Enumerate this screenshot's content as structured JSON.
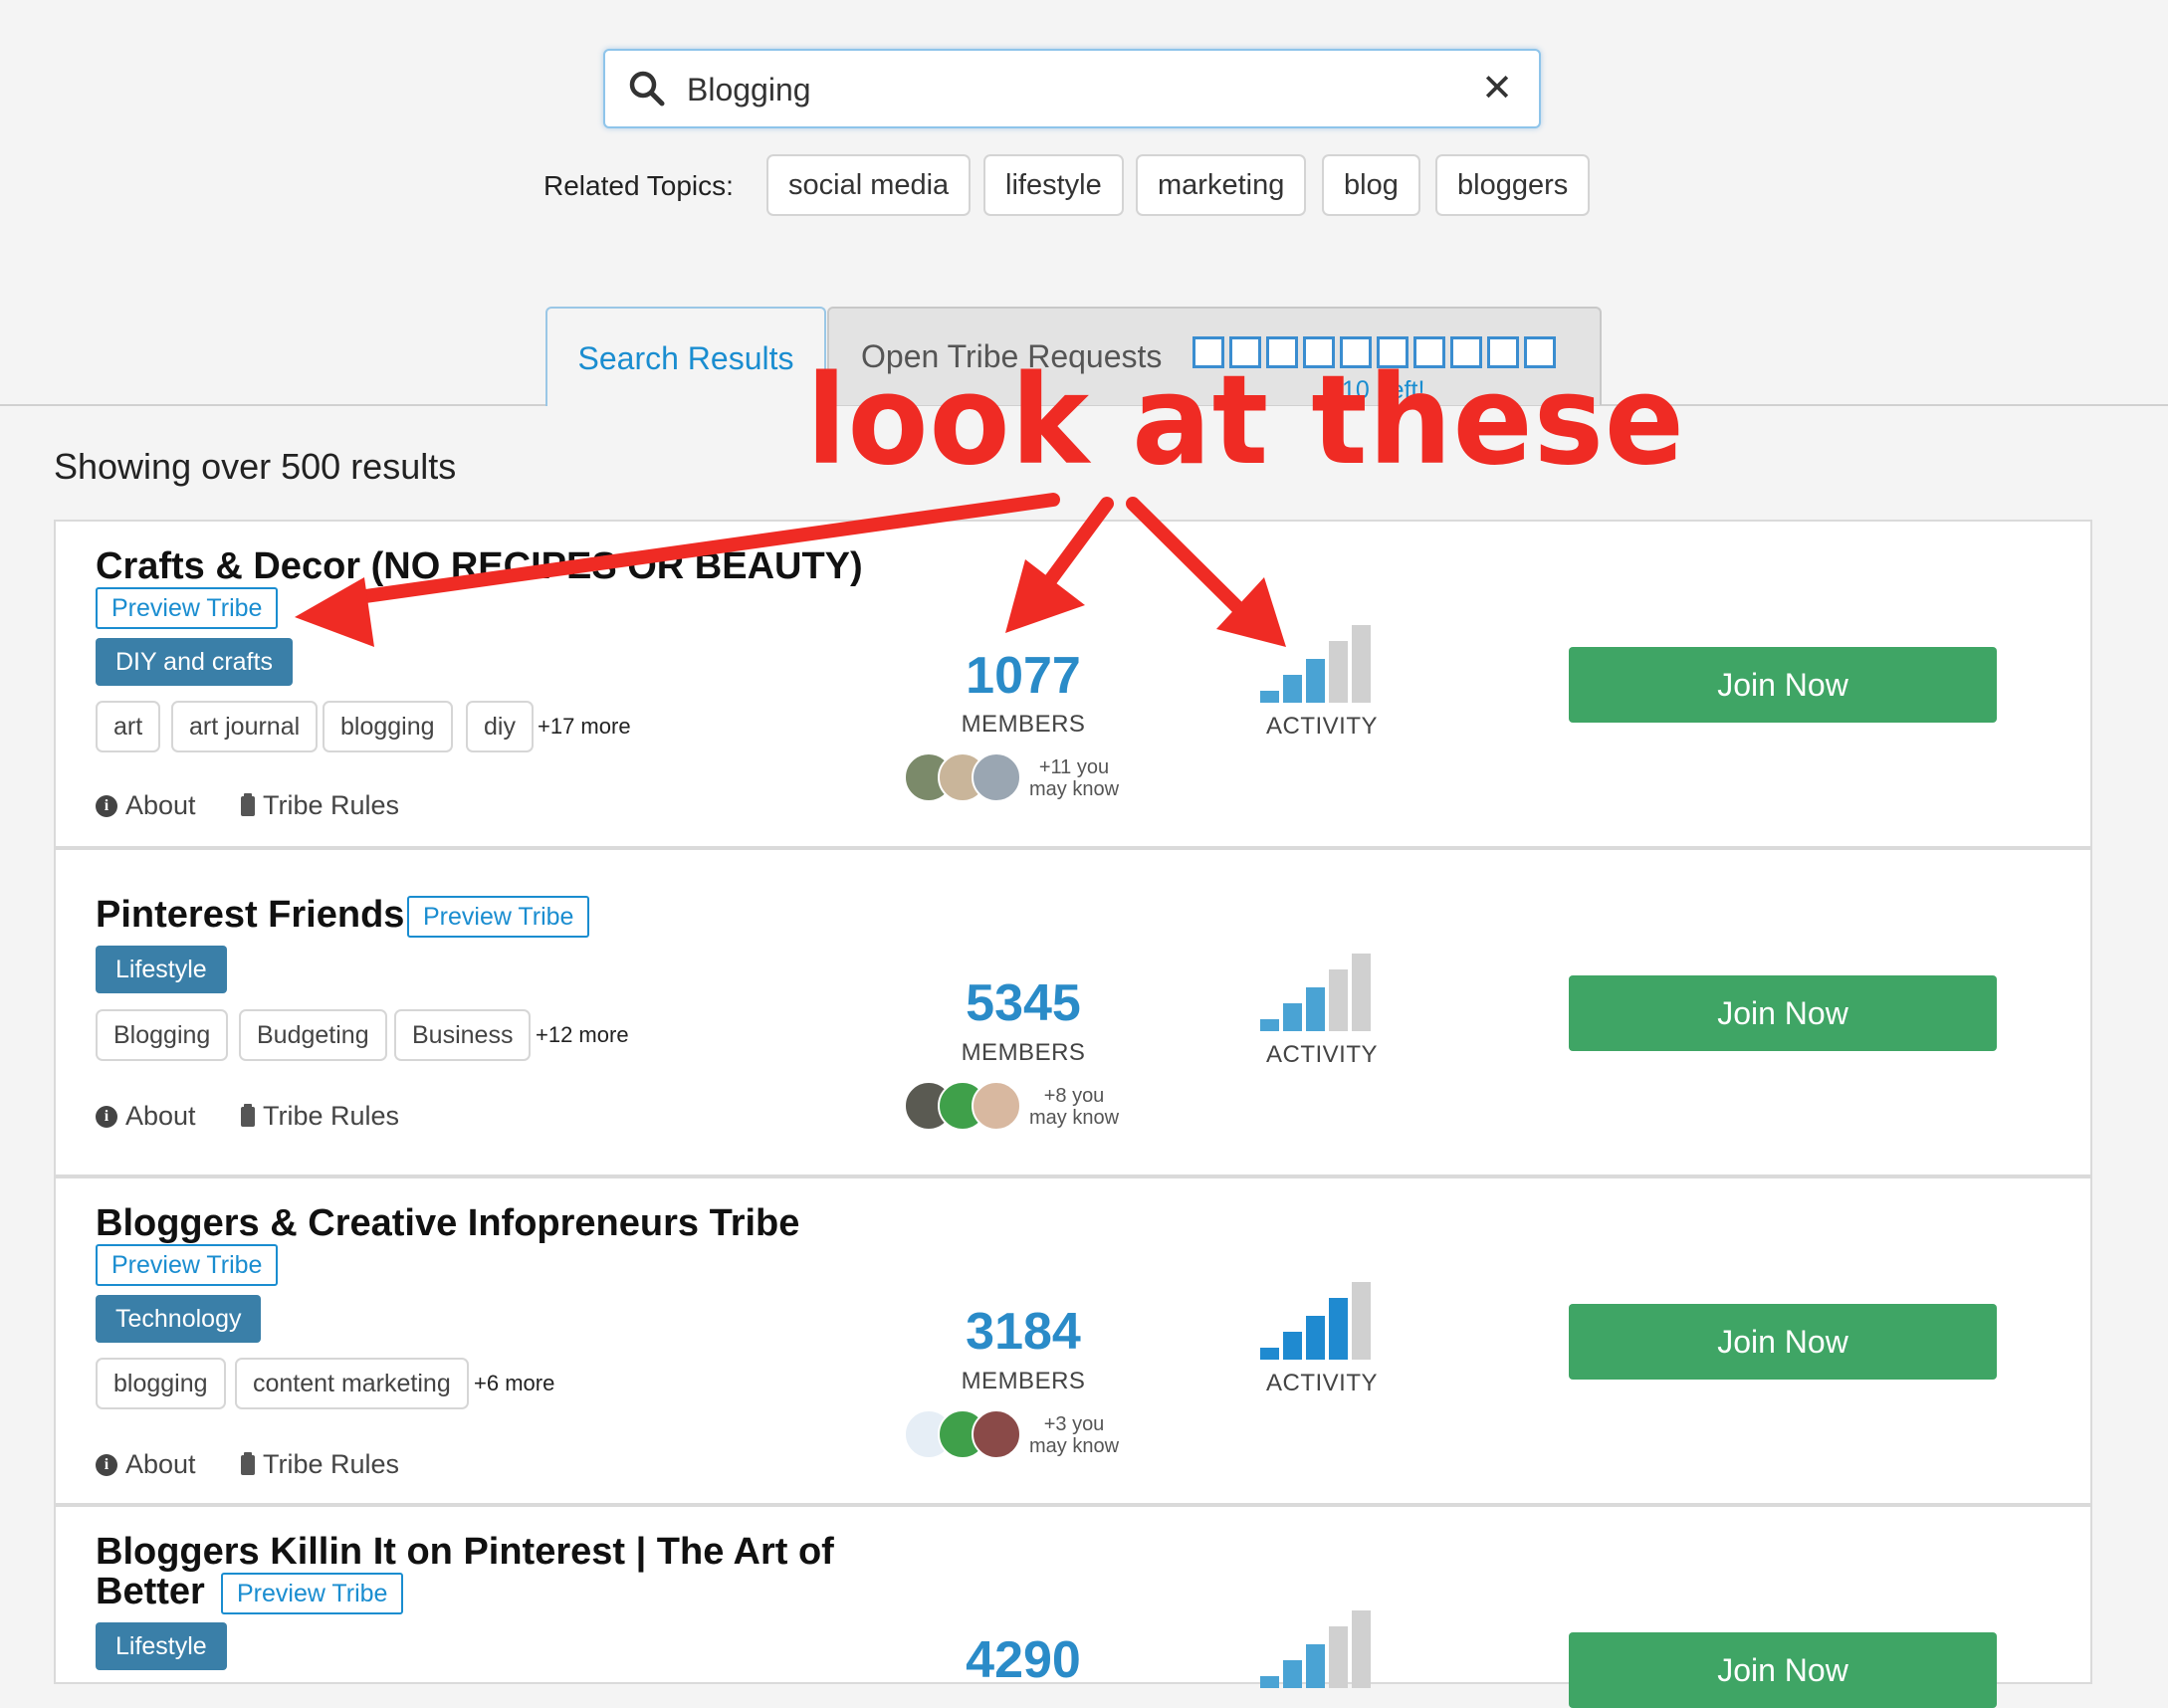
{
  "search": {
    "value": "Blogging",
    "clear_label": "✕"
  },
  "related": {
    "label": "Related Topics:",
    "topics": [
      "social media",
      "lifestyle",
      "marketing",
      "blog",
      "bloggers"
    ]
  },
  "tabs": {
    "search_results": "Search Results",
    "open_requests": "Open Tribe Requests",
    "requests_left": "10 Left!",
    "request_slots": 10
  },
  "results_count": "Showing over 500 results",
  "common": {
    "preview": "Preview Tribe",
    "about": "About",
    "rules": "Tribe Rules",
    "members": "MEMBERS",
    "activity": "ACTIVITY",
    "join": "Join Now",
    "you": "you",
    "may_know": "may know"
  },
  "tribes": [
    {
      "title": "Crafts & Decor (NO RECIPES OR BEAUTY)",
      "category": "DIY and crafts",
      "tags": [
        "art",
        "art journal",
        "blogging",
        "diy"
      ],
      "more": "+17 more",
      "members": "1077",
      "known": "+11",
      "activity_level": 3
    },
    {
      "title": "Pinterest Friends",
      "category": "Lifestyle",
      "tags": [
        "Blogging",
        "Budgeting",
        "Business"
      ],
      "more": "+12 more",
      "members": "5345",
      "known": "+8",
      "activity_level": 3
    },
    {
      "title": "Bloggers & Creative Infopreneurs Tribe",
      "category": "Technology",
      "tags": [
        "blogging",
        "content marketing"
      ],
      "more": "+6 more",
      "members": "3184",
      "known": "+3",
      "activity_level": 4
    },
    {
      "title_line1": "Bloggers Killin It on Pinterest | The Art of",
      "title_line2": "Better",
      "category": "Lifestyle",
      "members": "4290",
      "activity_level": 3
    }
  ],
  "annotation": {
    "text": "look at these",
    "color": "#ef2b24"
  },
  "colors": {
    "accent_blue": "#1a8dd0",
    "join_green": "#3fa565",
    "category_blue": "#3a7fa8",
    "bar_active": "#4aa3d4",
    "bar_active_full": "#1f8ad0",
    "bar_inactive": "#d0d0d0"
  }
}
